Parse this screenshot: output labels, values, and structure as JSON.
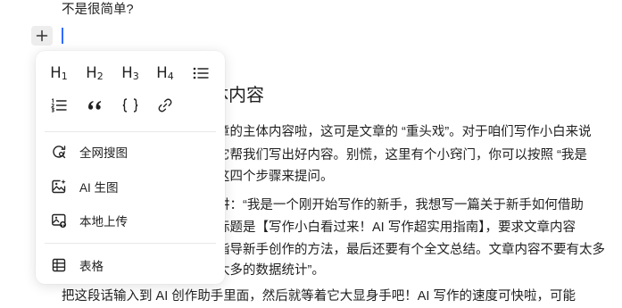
{
  "document": {
    "line_top": "不是很简单?",
    "heading_fragment": "体内容",
    "paragraph1": [
      "章的主体内容啦，这可是文章的 “重头戏”。对于咱们写作小白来说",
      "它帮我们写出好内容。别慌，这里有个小窍门，你可以按照 “我是",
      " 这四个步骤来提问。"
    ],
    "paragraph2": [
      "讲：“我是一个刚开始写作的新手，我想写一篇关于新手如何借助",
      "标题是【写作小白看过来！AI 写作超实用指南】，要求文章内容",
      "指导新手创作的方法，最后还要有个全文总结。文章内容不要有太多",
      "太多的数据统计”。"
    ],
    "line_bottom": "把这段话输入到 AI 创作助手里面，然后就等着它大显身手吧！AI 写作的速度可快啦，可能"
  },
  "insert_menu": {
    "format_buttons": [
      {
        "name": "heading-1-button",
        "base": "H",
        "sub": "1"
      },
      {
        "name": "heading-2-button",
        "base": "H",
        "sub": "2"
      },
      {
        "name": "heading-3-button",
        "base": "H",
        "sub": "3"
      },
      {
        "name": "heading-4-button",
        "base": "H",
        "sub": "4"
      }
    ],
    "icon_buttons": [
      "bulleted-list-icon",
      "numbered-list-icon",
      "quote-icon",
      "code-block-icon",
      "link-icon"
    ],
    "items": [
      {
        "label": "全网搜图",
        "icon": "web-image-search-icon"
      },
      {
        "label": "AI 生图",
        "icon": "ai-image-icon"
      },
      {
        "label": "本地上传",
        "icon": "local-upload-icon"
      },
      {
        "label": "表格",
        "icon": "table-icon"
      }
    ]
  },
  "colors": {
    "caret": "#2f6bff",
    "plus_bg": "#ededed",
    "text": "#1f1f1f"
  }
}
